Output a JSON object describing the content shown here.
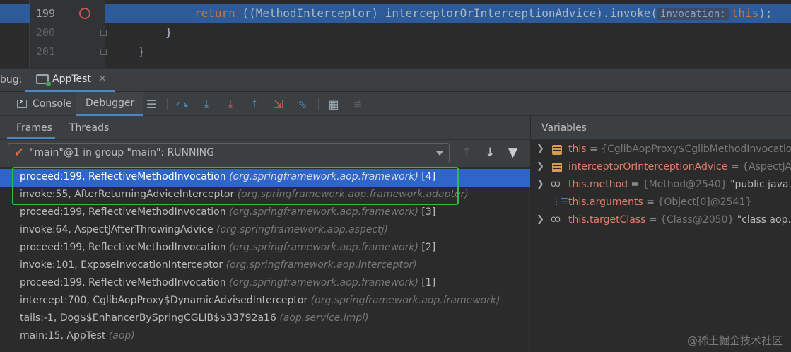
{
  "editor": {
    "lines": [
      {
        "number": "199",
        "keyword": "return",
        "code": " ((MethodInterceptor) interceptorOrInterceptionAdvice).invoke(",
        "hint": "invocation:",
        "arg": "this",
        "tail": ");"
      },
      {
        "number": "200",
        "code": "}"
      },
      {
        "number": "201",
        "code": "}"
      }
    ]
  },
  "debug_bar": {
    "label": "bug:",
    "run_tab": "AppTest",
    "close": "×"
  },
  "toolbar": {
    "console": "Console",
    "debugger": "Debugger"
  },
  "frames_panel": {
    "tabs": [
      "Frames",
      "Threads"
    ],
    "thread": "\"main\"@1 in group \"main\": RUNNING",
    "frames": [
      {
        "method": "proceed:199, ReflectiveMethodInvocation",
        "pkg": "(org.springframework.aop.framework)",
        "idx": "[4]"
      },
      {
        "method": "invoke:55, AfterReturningAdviceInterceptor",
        "pkg": "(org.springframework.aop.framework.adapter)",
        "idx": ""
      },
      {
        "method": "proceed:199, ReflectiveMethodInvocation",
        "pkg": "(org.springframework.aop.framework)",
        "idx": "[3]"
      },
      {
        "method": "invoke:64, AspectJAfterThrowingAdvice",
        "pkg": "(org.springframework.aop.aspectj)",
        "idx": ""
      },
      {
        "method": "proceed:199, ReflectiveMethodInvocation",
        "pkg": "(org.springframework.aop.framework)",
        "idx": "[2]"
      },
      {
        "method": "invoke:101, ExposeInvocationInterceptor",
        "pkg": "(org.springframework.aop.interceptor)",
        "idx": ""
      },
      {
        "method": "proceed:199, ReflectiveMethodInvocation",
        "pkg": "(org.springframework.aop.framework)",
        "idx": "[1]"
      },
      {
        "method": "intercept:700, CglibAopProxy$DynamicAdvisedInterceptor",
        "pkg": "(org.springframework.aop.framework)",
        "idx": ""
      },
      {
        "method": "tails:-1, Dog$$EnhancerBySpringCGLIB$$33792a16",
        "pkg": "(aop.service.impl)",
        "idx": ""
      },
      {
        "method": "main:15, AppTest",
        "pkg": "(aop)",
        "idx": ""
      }
    ]
  },
  "variables": {
    "title": "Variables",
    "items": [
      {
        "name": "this",
        "eq": " = ",
        "type": "{CglibAopProxy$CglibMethodInvocation",
        "value": ""
      },
      {
        "name": "interceptorOrInterceptionAdvice",
        "eq": " = ",
        "type": "{AspectJAfte",
        "value": ""
      },
      {
        "name": "this.method",
        "eq": " = ",
        "type": "{Method@2540}",
        "value": " \"public java.lan"
      },
      {
        "name": "this.arguments",
        "eq": " = ",
        "type": "{Object[0]@2541}",
        "value": ""
      },
      {
        "name": "this.targetClass",
        "eq": " = ",
        "type": "{Class@2050}",
        "value": " \"class aop.servic"
      }
    ]
  },
  "watermark": "@稀土掘金技术社区"
}
